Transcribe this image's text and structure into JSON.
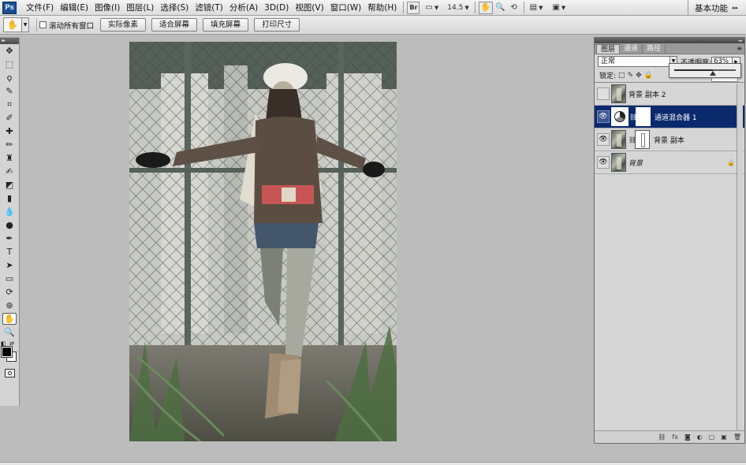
{
  "app": {
    "logo": "Ps",
    "menu": [
      "文件(F)",
      "编辑(E)",
      "图像(I)",
      "图层(L)",
      "选择(S)",
      "滤镜(T)",
      "分析(A)",
      "3D(D)",
      "视图(V)",
      "窗口(W)",
      "帮助(H)"
    ],
    "zoom_label": "14.5",
    "workspace_label": "基本功能",
    "mb_icons": {
      "bridge": "Br",
      "screen_mode": "▭",
      "hand": "✋",
      "zoom": "🔍",
      "rotate": "⟲",
      "arrange": "▤",
      "screen": "▣"
    }
  },
  "options": {
    "scroll_all_label": "滚动所有窗口",
    "scroll_all_checked": false,
    "buttons": [
      "实际像素",
      "适合屏幕",
      "填充屏幕",
      "打印尺寸"
    ]
  },
  "toolbox": {
    "tools": [
      {
        "name": "move-tool",
        "glyph": "✥"
      },
      {
        "name": "marquee-tool",
        "glyph": "⬚"
      },
      {
        "name": "lasso-tool",
        "glyph": "ϙ"
      },
      {
        "name": "quick-select-tool",
        "glyph": "✎"
      },
      {
        "name": "crop-tool",
        "glyph": "⌗"
      },
      {
        "name": "eyedropper-tool",
        "glyph": "✐"
      },
      {
        "name": "healing-brush-tool",
        "glyph": "✚"
      },
      {
        "name": "brush-tool",
        "glyph": "✏"
      },
      {
        "name": "clone-stamp-tool",
        "glyph": "♜"
      },
      {
        "name": "history-brush-tool",
        "glyph": "✍"
      },
      {
        "name": "eraser-tool",
        "glyph": "◩"
      },
      {
        "name": "gradient-tool",
        "glyph": "▮"
      },
      {
        "name": "blur-tool",
        "glyph": "💧"
      },
      {
        "name": "dodge-tool",
        "glyph": "●"
      },
      {
        "name": "pen-tool",
        "glyph": "✒"
      },
      {
        "name": "type-tool",
        "glyph": "T"
      },
      {
        "name": "path-select-tool",
        "glyph": "➤"
      },
      {
        "name": "shape-tool",
        "glyph": "▭"
      },
      {
        "name": "3d-rotate-tool",
        "glyph": "⟳"
      },
      {
        "name": "3d-orbit-tool",
        "glyph": "⊛"
      },
      {
        "name": "hand-tool",
        "glyph": "✋",
        "active": true
      },
      {
        "name": "zoom-tool",
        "glyph": "🔍"
      }
    ],
    "colors": {
      "foreground": "#000000",
      "background": "#ffffff"
    }
  },
  "layers_panel": {
    "tabs": [
      "图层",
      "通道",
      "路径"
    ],
    "active_tab": 0,
    "blend_mode": "正常",
    "opacity_label": "不透明度:",
    "opacity_value": "63%",
    "opacity_fraction": 0.63,
    "lock_label": "锁定:",
    "lock_icons": [
      "□",
      "✎",
      "✥",
      "🔒"
    ],
    "layers": [
      {
        "name": "背景 副本 2",
        "visible": false,
        "type": "pixel",
        "selected": false
      },
      {
        "name": "通道混合器 1",
        "visible": true,
        "type": "adjustment",
        "selected": true
      },
      {
        "name": "背景 副本",
        "visible": true,
        "type": "masked",
        "selected": false
      },
      {
        "name": "背景",
        "visible": true,
        "type": "background",
        "selected": false,
        "locked": true
      }
    ],
    "footer_icons": [
      "⛓",
      "fx",
      "◙",
      "◐",
      "▢",
      "▣",
      "🗑"
    ]
  }
}
